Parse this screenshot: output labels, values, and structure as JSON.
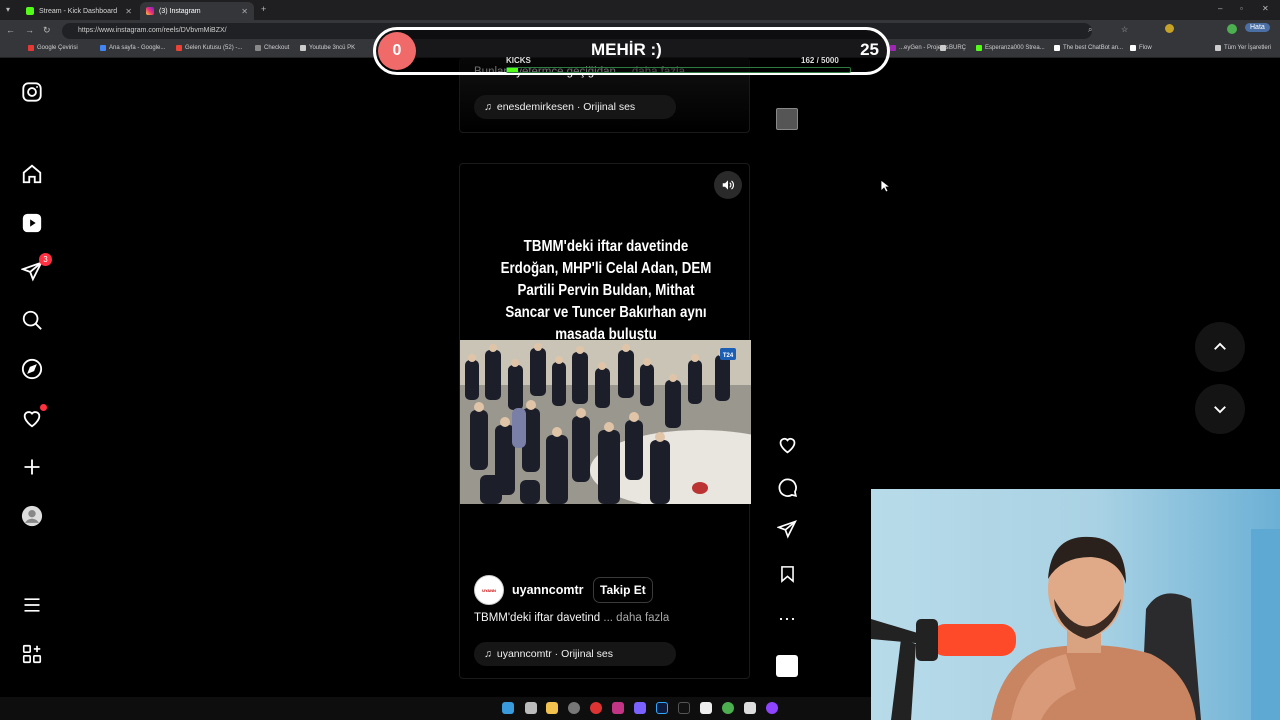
{
  "browser": {
    "tabs": [
      {
        "title": "Stream - Kick Dashboard",
        "active": false
      },
      {
        "title": "(3) Instagram",
        "active": true
      }
    ],
    "url": "https://www.instagram.com/reels/DVbvmMiBZX/",
    "profile_label": "Hata",
    "bookmarks": [
      "Google Çevirisi",
      "Ana sayfa - Google...",
      "Gelen Kutusu (52) -...",
      "Checkout",
      "Youtube 3ncü PK",
      "...ng Örnek",
      "Transcript of \"Mi M...",
      "CapCut | Text to sp...",
      "...Tube Thumbnail...",
      "Resize and reduce i...",
      "İspanyolca Ö...",
      "...eyGen - Projects",
      "BURÇ",
      "Esperanza000 Strea...",
      "The best ChatBot an...",
      "Flow",
      "Tüm Yer İşaretleri"
    ]
  },
  "overlay": {
    "left_number": "0",
    "title": "MEHİR :)",
    "right_number": "25",
    "kicks_label": "KICKS",
    "kicks_count": "162 / 5000",
    "kicks_progress": 0.032
  },
  "reel1": {
    "caption": "Bunlar...yetermce geçiğidan",
    "more": "... daha fazla",
    "audio": "enesdemirkesen · Orijinal ses"
  },
  "reel2": {
    "headline": "TBMM'deki iftar davetinde Erdoğan, MHP'li Celal Adan, DEM Partili Pervin Buldan, Mithat Sancar ve Tuncer Bakırhan aynı masada buluştu",
    "photo_badge": "T24",
    "username": "uyanncomtr",
    "avatar_text": "UYANN",
    "follow_label": "Takip Et",
    "caption": "TBMM'deki iftar davetind",
    "more": "... daha fazla",
    "audio": "uyanncomtr · Orijinal ses"
  },
  "sidebar": {
    "messages_badge": "3"
  },
  "colors": {
    "badge": "#ff3040",
    "overlay_left": "#f06a6a",
    "background": "#000000"
  }
}
